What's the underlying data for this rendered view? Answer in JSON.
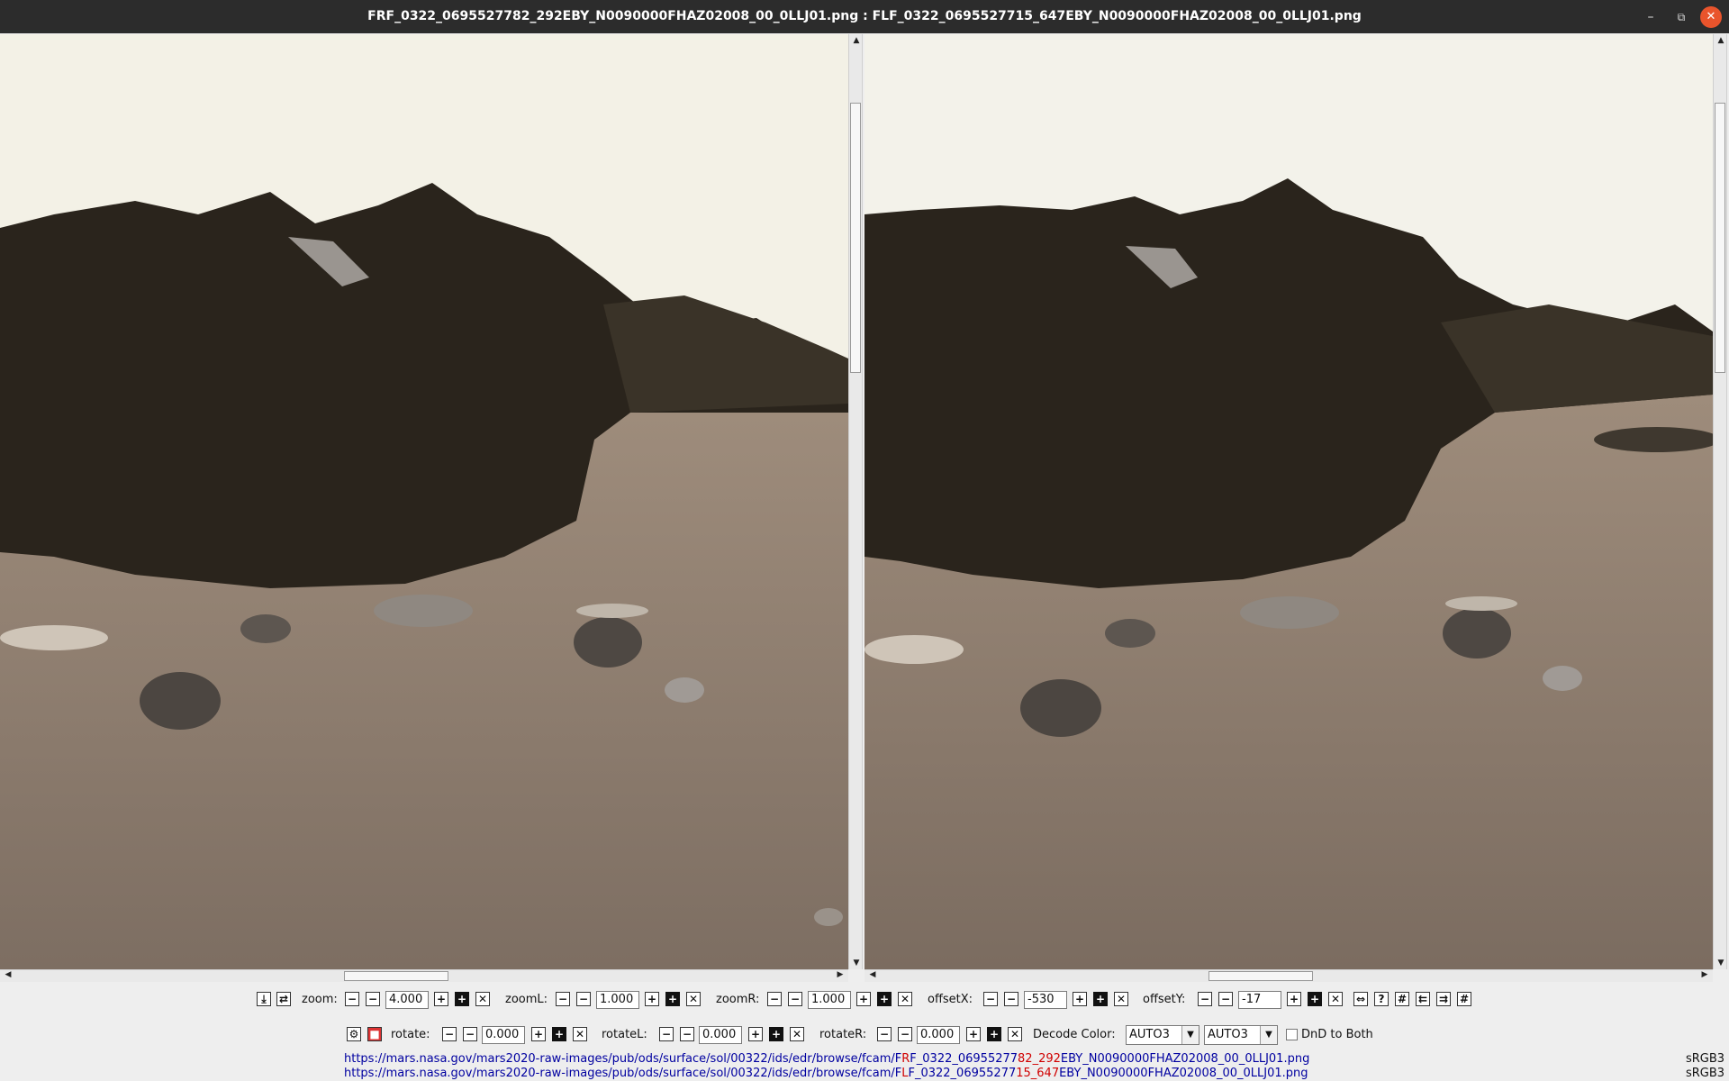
{
  "window": {
    "title": "FRF_0322_0695527782_292EBY_N0090000FHAZ02008_00_0LLJ01.png : FLF_0322_0695527715_647EBY_N0090000FHAZ02008_00_0LLJ01.png",
    "minimize_glyph": "–",
    "maximize_glyph": "⧉",
    "close_glyph": "✕"
  },
  "toolbar1": {
    "zoom_label": "zoom:",
    "zoom_value": "4.000",
    "zoomL_label": "zoomL:",
    "zoomL_value": "1.000",
    "zoomR_label": "zoomR:",
    "zoomR_value": "1.000",
    "offsetX_label": "offsetX:",
    "offsetX_value": "-530",
    "offsetY_label": "offsetY:",
    "offsetY_value": "-17"
  },
  "toolbar2": {
    "rotate_label": "rotate:",
    "rotate_value": "0.000",
    "rotateL_label": "rotateL:",
    "rotateL_value": "0.000",
    "rotateR_label": "rotateR:",
    "rotateR_value": "0.000",
    "decode_label": "Decode Color:",
    "decode_left": "AUTO3",
    "decode_right": "AUTO3",
    "dnd_label": "DnD to Both"
  },
  "icons": {
    "minus": "−",
    "plus": "+",
    "reset": "✕",
    "dropdown": "▼",
    "help": "?"
  },
  "urls": {
    "url1_prefix": "https://mars.nasa.gov/mars2020-raw-images/pub/ods/surface/sol/00322/ids/edr/browse/fcam/F",
    "url1_diff1": "R",
    "url1_mid": "F_0322_06955277",
    "url1_diff2": "82_292",
    "url1_suffix": "EBY_N0090000FHAZ02008_00_0LLJ01.png",
    "url2_prefix": "https://mars.nasa.gov/mars2020-raw-images/pub/ods/surface/sol/00322/ids/edr/browse/fcam/F",
    "url2_diff1": "L",
    "url2_mid": "F_0322_06955277",
    "url2_diff2": "15_647",
    "url2_suffix": "EBY_N0090000FHAZ02008_00_0LLJ01.png",
    "colorspace1": "sRGB3",
    "colorspace2": "sRGB3"
  },
  "colors": {
    "sky": "#f3f1e6",
    "rock": "#2a241c",
    "ground": "#8a7868",
    "accent_close": "#e9542c",
    "url_link": "#0000a0",
    "url_diff": "#d00000"
  }
}
